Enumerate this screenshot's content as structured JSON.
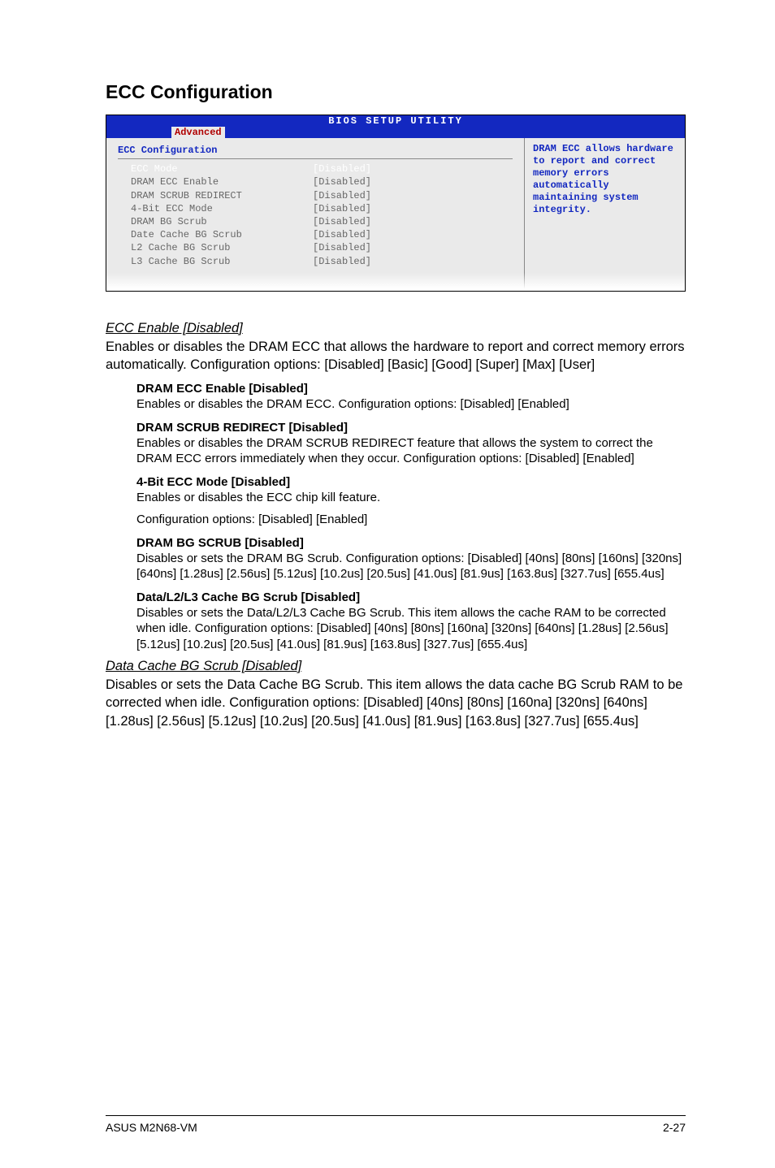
{
  "section_title": "ECC Configuration",
  "bios": {
    "title": "BIOS SETUP UTILITY",
    "active_tab": "Advanced",
    "panel_heading": "ECC Configuration",
    "rows": [
      {
        "label": "ECC Mode",
        "value": "[Disabled]",
        "selected": true
      },
      {
        "label": "DRAM ECC Enable",
        "value": "[Disabled]"
      },
      {
        "label": "DRAM SCRUB REDIRECT",
        "value": "[Disabled]"
      },
      {
        "label": "4-Bit ECC Mode",
        "value": "[Disabled]"
      },
      {
        "label": "DRAM BG Scrub",
        "value": "[Disabled]"
      },
      {
        "label": "Date Cache BG Scrub",
        "value": "[Disabled]"
      },
      {
        "label": "L2 Cache BG Scrub",
        "value": "[Disabled]"
      },
      {
        "label": "L3 Cache BG Scrub",
        "value": "[Disabled]"
      }
    ],
    "help_text": "DRAM ECC allows hardware to report and correct memory errors automatically maintaining system integrity."
  },
  "ecc_enable": {
    "title": "ECC Enable [Disabled]",
    "body": "Enables or disables the DRAM ECC that allows the hardware to report and correct memory errors automatically. Configuration options: [Disabled] [Basic] [Good] [Super] [Max] [User]"
  },
  "sub": {
    "dram_ecc_enable": {
      "title": "DRAM ECC Enable [Disabled]",
      "body": "Enables or disables the DRAM ECC. Configuration options: [Disabled] [Enabled]"
    },
    "dram_scrub_redirect": {
      "title": "DRAM SCRUB REDIRECT [Disabled]",
      "body": "Enables or disables the DRAM SCRUB REDIRECT feature that allows the system to correct the DRAM ECC errors immediately when they occur. Configuration options: [Disabled] [Enabled]"
    },
    "four_bit": {
      "title": "4-Bit ECC Mode [Disabled]",
      "body1": "Enables or disables the ECC chip kill feature.",
      "body2": "Configuration options: [Disabled] [Enabled]"
    },
    "dram_bg_scrub": {
      "title": "DRAM BG SCRUB [Disabled]",
      "body": "Disables or sets the DRAM BG Scrub. Configuration options: [Disabled] [40ns] [80ns] [160ns] [320ns] [640ns] [1.28us] [2.56us] [5.12us] [10.2us] [20.5us] [41.0us] [81.9us] [163.8us] [327.7us] [655.4us]"
    },
    "data_cache_bg": {
      "title": "Data/L2/L3 Cache BG Scrub [Disabled]",
      "body": "Disables or sets the Data/L2/L3 Cache BG Scrub. This item allows the cache RAM to be corrected when idle. Configuration options: [Disabled] [40ns] [80ns] [160na] [320ns] [640ns] [1.28us] [2.56us] [5.12us] [10.2us] [20.5us] [41.0us] [81.9us] [163.8us] [327.7us] [655.4us]"
    }
  },
  "data_cache_section": {
    "title": "Data Cache BG Scrub [Disabled]",
    "body": "Disables or sets the Data Cache BG Scrub. This item allows the data cache BG Scrub RAM to be corrected when idle. Configuration options: [Disabled] [40ns] [80ns] [160na] [320ns] [640ns] [1.28us] [2.56us] [5.12us] [10.2us] [20.5us] [41.0us] [81.9us] [163.8us] [327.7us] [655.4us]"
  },
  "footer": {
    "left": "ASUS M2N68-VM",
    "right": "2-27"
  }
}
